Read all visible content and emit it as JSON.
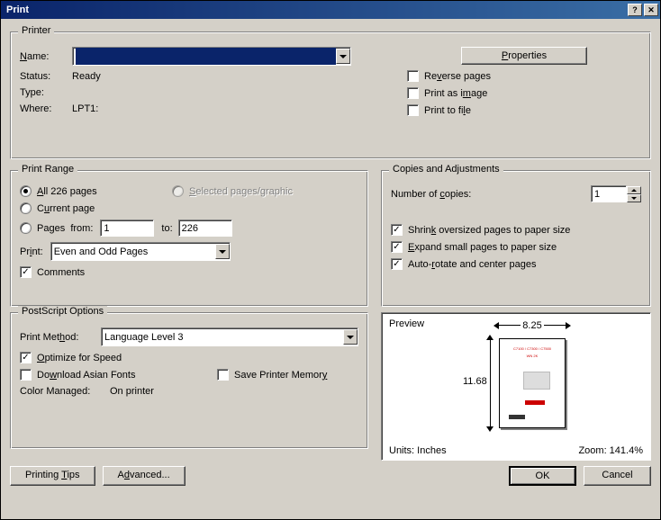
{
  "title": "Print",
  "printer": {
    "legend": "Printer",
    "name_label": "Name:",
    "name_value": "",
    "properties_btn": "Properties",
    "status_label": "Status:",
    "status_value": "Ready",
    "type_label": "Type:",
    "type_value": "",
    "where_label": "Where:",
    "where_value": "LPT1:",
    "reverse_pages": "Reverse pages",
    "print_as_image": "Print as image",
    "print_to_file": "Print to file"
  },
  "range": {
    "legend": "Print Range",
    "all_pages": "All 226 pages",
    "selected": "Selected pages/graphic",
    "current_page": "Current page",
    "pages": "Pages",
    "from": "from:",
    "from_value": "1",
    "to": "to:",
    "to_value": "226",
    "print_label": "Print:",
    "print_value": "Even and Odd Pages",
    "comments": "Comments"
  },
  "copies": {
    "legend": "Copies and Adjustments",
    "num_copies": "Number of copies:",
    "num_copies_value": "1",
    "shrink": "Shrink oversized pages to paper size",
    "expand": "Expand small pages to paper size",
    "autorotate": "Auto-rotate and center pages"
  },
  "postscript": {
    "legend": "PostScript Options",
    "method_label": "Print Method:",
    "method_value": "Language Level 3",
    "optimize": "Optimize for Speed",
    "download_asian": "Download Asian Fonts",
    "save_memory": "Save Printer Memory",
    "color_managed_label": "Color Managed:",
    "color_managed_value": "On printer"
  },
  "preview": {
    "label": "Preview",
    "width": "8.25",
    "height": "11.68",
    "units_label": "Units: Inches",
    "zoom_label": "Zoom: 141.4%"
  },
  "buttons": {
    "printing_tips": "Printing Tips",
    "advanced": "Advanced...",
    "ok": "OK",
    "cancel": "Cancel"
  }
}
